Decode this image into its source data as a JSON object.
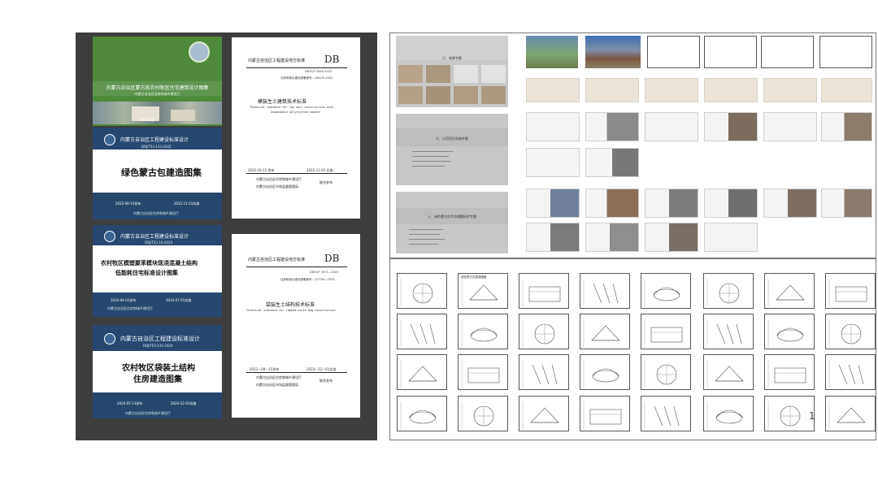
{
  "covers": {
    "green": {
      "title": "内蒙古自治区蒙古族农村牧区住宅建筑设计图集",
      "subtitle": "内蒙古自治区住房和城乡建设厅",
      "edition": "2022年版"
    },
    "blue1": {
      "header": "内蒙古自治区工程建设标准设计",
      "code": "DBJ/T03-133-2022",
      "title": "绿色蒙古包建造图集",
      "date_left": "2022-08-10发布",
      "date_right": "2022-11-01实施",
      "issuer": "内蒙古自治区住房和城乡建设厅"
    },
    "blue2": {
      "header": "内蒙古自治区工程建设标准设计",
      "code": "DBJ/T03-10-2024",
      "title_line1": "农村牧区模塑聚苯模块现浇混凝土结构",
      "title_line2": "低能耗住宅标准设计图集",
      "date_left": "2024-04-01发布",
      "date_right": "2024-07-01实施",
      "issuer": "内蒙古自治区住房和城乡建设厅"
    },
    "blue3": {
      "header": "内蒙古自治区工程建设标准设计",
      "code": "DBJ/T03-135-2024",
      "title_line1": "农村牧区袋装土结构",
      "title_line2": "住房建造图集",
      "date_left": "2024-05-13发布",
      "date_right": "2024-12-01实施",
      "issuer": "内蒙古自治区住房和城乡建设厅"
    },
    "std1": {
      "header": "内蒙古自治区工程建设地方标准",
      "db": "DB",
      "code": "DB15/T 4445-2022",
      "filing": "住房和城乡建设部备案号：J16470-2022",
      "title": "模装生土建筑技术标准",
      "en1": "Technical standard for raw soil construction with",
      "en2": "expandable polystyrene module",
      "date_left": "2022-10-11 发布",
      "date_right": "2022-11-01 实施",
      "issuer1": "内蒙古自治区住房和城乡建设厅",
      "issuer2": "内蒙古自治区市场监督管理局",
      "joint": "联合发布"
    },
    "std2": {
      "header": "内蒙古自治区工程建设地方标准",
      "db": "DB",
      "code": "DB15/T 3071—2023",
      "filing": "住房和城乡建设部备案号：J17754—2024",
      "title": "袋装生土结构技术标准",
      "en1": "Technical standard for rammed earth bag construction",
      "date_left": "2023—09—15发布",
      "date_right": "2023—12—01实施",
      "issuer1": "内蒙古自治区住房和城乡建设厅",
      "issuer2": "内蒙古自治区市场监督管理局",
      "joint": "联合发布"
    }
  },
  "slides": {
    "s1": "六、效果专题",
    "s2": "七、示范项目实施专题",
    "s3": "八、绿色蒙古包专项课题研究专题"
  },
  "drawing_sheet_label": "绿色蒙古包建造图集",
  "page_number": "1",
  "colors": {
    "blue": "#27476f",
    "green": "#4f8a3b",
    "dark_panel": "#3d3d3d"
  }
}
